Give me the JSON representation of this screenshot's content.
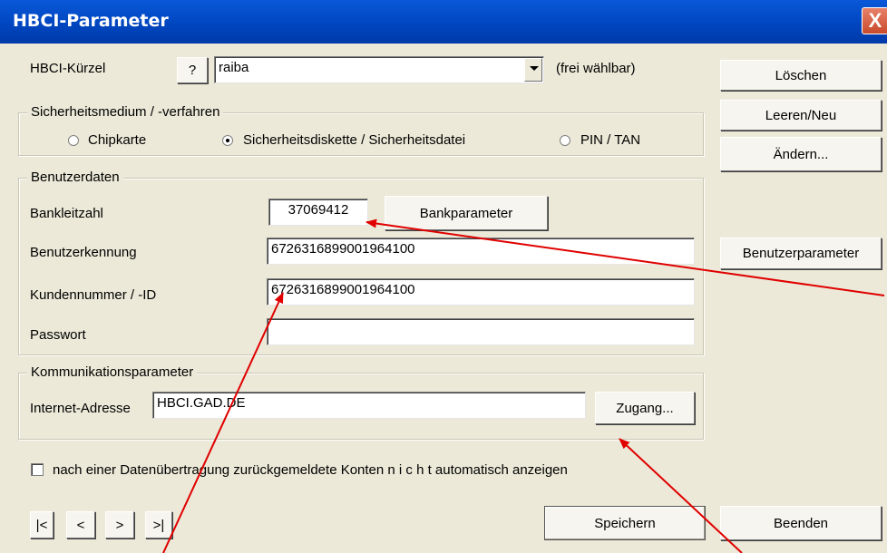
{
  "window": {
    "title": "HBCI-Parameter",
    "close_label": "X"
  },
  "kuerzel": {
    "label": "HBCI-Kürzel",
    "help_label": "?",
    "value": "raiba",
    "hint": "(frei wählbar)"
  },
  "right_buttons": {
    "loeschen": "Löschen",
    "leeren": "Leeren/Neu",
    "aendern": "Ändern...",
    "benutzerparameter": "Benutzerparameter"
  },
  "medium": {
    "legend": "Sicherheitsmedium / -verfahren",
    "options": [
      "Chipkarte",
      "Sicherheitsdiskette / Sicherheitsdatei",
      "PIN / TAN"
    ],
    "selected": "Sicherheitsdiskette / Sicherheitsdatei"
  },
  "benutzer": {
    "legend": "Benutzerdaten",
    "blz_label": "Bankleitzahl",
    "blz_value": "37069412",
    "bankparameter_label": "Bankparameter",
    "kennung_label": "Benutzerkennung",
    "kennung_value": "6726316899001964100",
    "kunden_label": "Kundennummer / -ID",
    "kunden_value": "6726316899001964100",
    "passwort_label": "Passwort",
    "passwort_value": ""
  },
  "komm": {
    "legend": "Kommunikationsparameter",
    "adresse_label": "Internet-Adresse",
    "adresse_value": "HBCI.GAD.DE",
    "zugang_label": "Zugang..."
  },
  "checkbox": {
    "label": "nach einer Datenübertragung zurückgemeldete Konten  n i c h t  automatisch anzeigen",
    "checked": false
  },
  "nav": {
    "first": "|<",
    "prev": "<",
    "next": ">",
    "last": ">|"
  },
  "bottom": {
    "speichern": "Speichern",
    "beenden": "Beenden"
  },
  "colors": {
    "title_bar": "#0046c0",
    "dialog_bg": "#ece9d8",
    "annotation_arrows": "#e00000"
  }
}
